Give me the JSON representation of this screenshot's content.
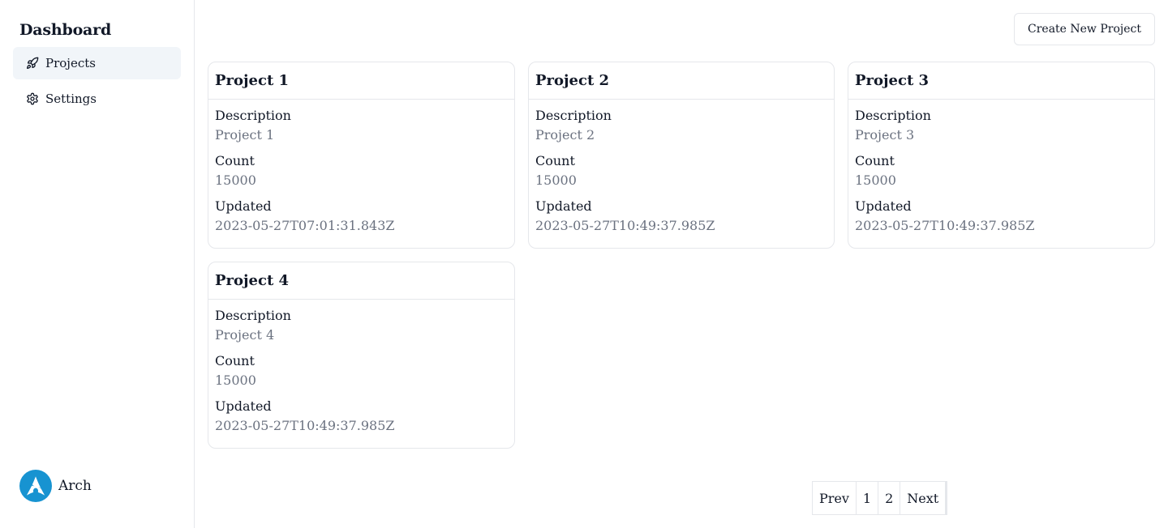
{
  "sidebar": {
    "brand": "Dashboard",
    "items": [
      {
        "label": "Projects",
        "icon": "rocket-icon",
        "active": true
      },
      {
        "label": "Settings",
        "icon": "gear-icon",
        "active": false
      }
    ],
    "user": {
      "name": "Arch",
      "avatar_color": "#1793d1"
    }
  },
  "toolbar": {
    "create_label": "Create New Project"
  },
  "projects": [
    {
      "title": "Project 1",
      "description_label": "Description",
      "description": "Project 1",
      "count_label": "Count",
      "count": "15000",
      "updated_label": "Updated",
      "updated": "2023-05-27T07:01:31.843Z"
    },
    {
      "title": "Project 2",
      "description_label": "Description",
      "description": "Project 2",
      "count_label": "Count",
      "count": "15000",
      "updated_label": "Updated",
      "updated": "2023-05-27T10:49:37.985Z"
    },
    {
      "title": "Project 3",
      "description_label": "Description",
      "description": "Project 3",
      "count_label": "Count",
      "count": "15000",
      "updated_label": "Updated",
      "updated": "2023-05-27T10:49:37.985Z"
    },
    {
      "title": "Project 4",
      "description_label": "Description",
      "description": "Project 4",
      "count_label": "Count",
      "count": "15000",
      "updated_label": "Updated",
      "updated": "2023-05-27T10:49:37.985Z"
    }
  ],
  "pagination": {
    "prev": "Prev",
    "pages": [
      "1",
      "2"
    ],
    "next": "Next"
  },
  "colors": {
    "border": "#e5e7eb",
    "active_nav": "#f1f5f9",
    "muted_text": "#6b7280"
  }
}
